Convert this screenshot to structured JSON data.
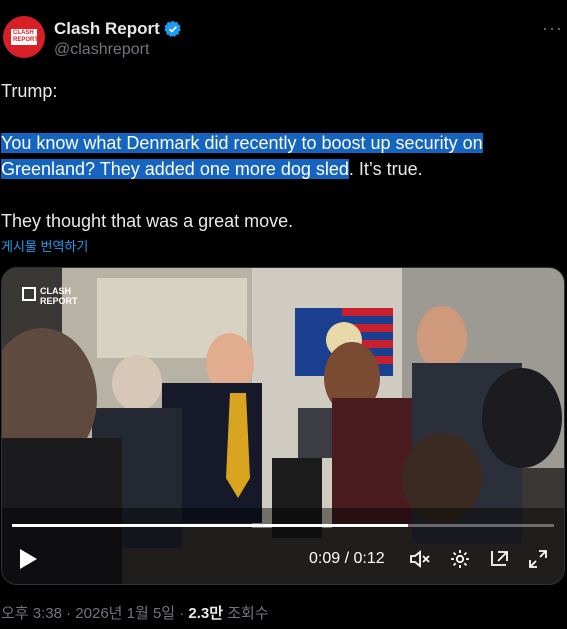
{
  "author": {
    "display_name": "Clash Report",
    "handle": "@clashreport",
    "avatar_logo": "CLASH REPORT",
    "verified": true,
    "more_icon": "more-options-icon"
  },
  "tweet": {
    "line1": "Trump:",
    "line2_highlight": "You know what Denmark did recently to boost up security on Greenland? They added one more dog sled",
    "line2_rest": ". It’s true.",
    "line3": "They thought that was a great move.",
    "translate_label": "게시물 번역하기"
  },
  "video": {
    "watermark": "CLASH REPORT",
    "current_time": "0:09",
    "separator": "/",
    "duration": "0:12",
    "progress_fraction": 0.73,
    "controls": [
      "play-icon",
      "mute-icon",
      "settings-icon",
      "popout-icon",
      "fullscreen-icon"
    ]
  },
  "meta": {
    "timestamp": "오후 3:38 · 2026년 1월 5일 · ",
    "views_count": "2.3만",
    "views_label": " 조회수"
  },
  "colors": {
    "background": "#000000",
    "text": "#e7e9ea",
    "muted": "#71767b",
    "link": "#1d9bf0",
    "highlight": "#1565c0",
    "brand": "#d81f26"
  }
}
